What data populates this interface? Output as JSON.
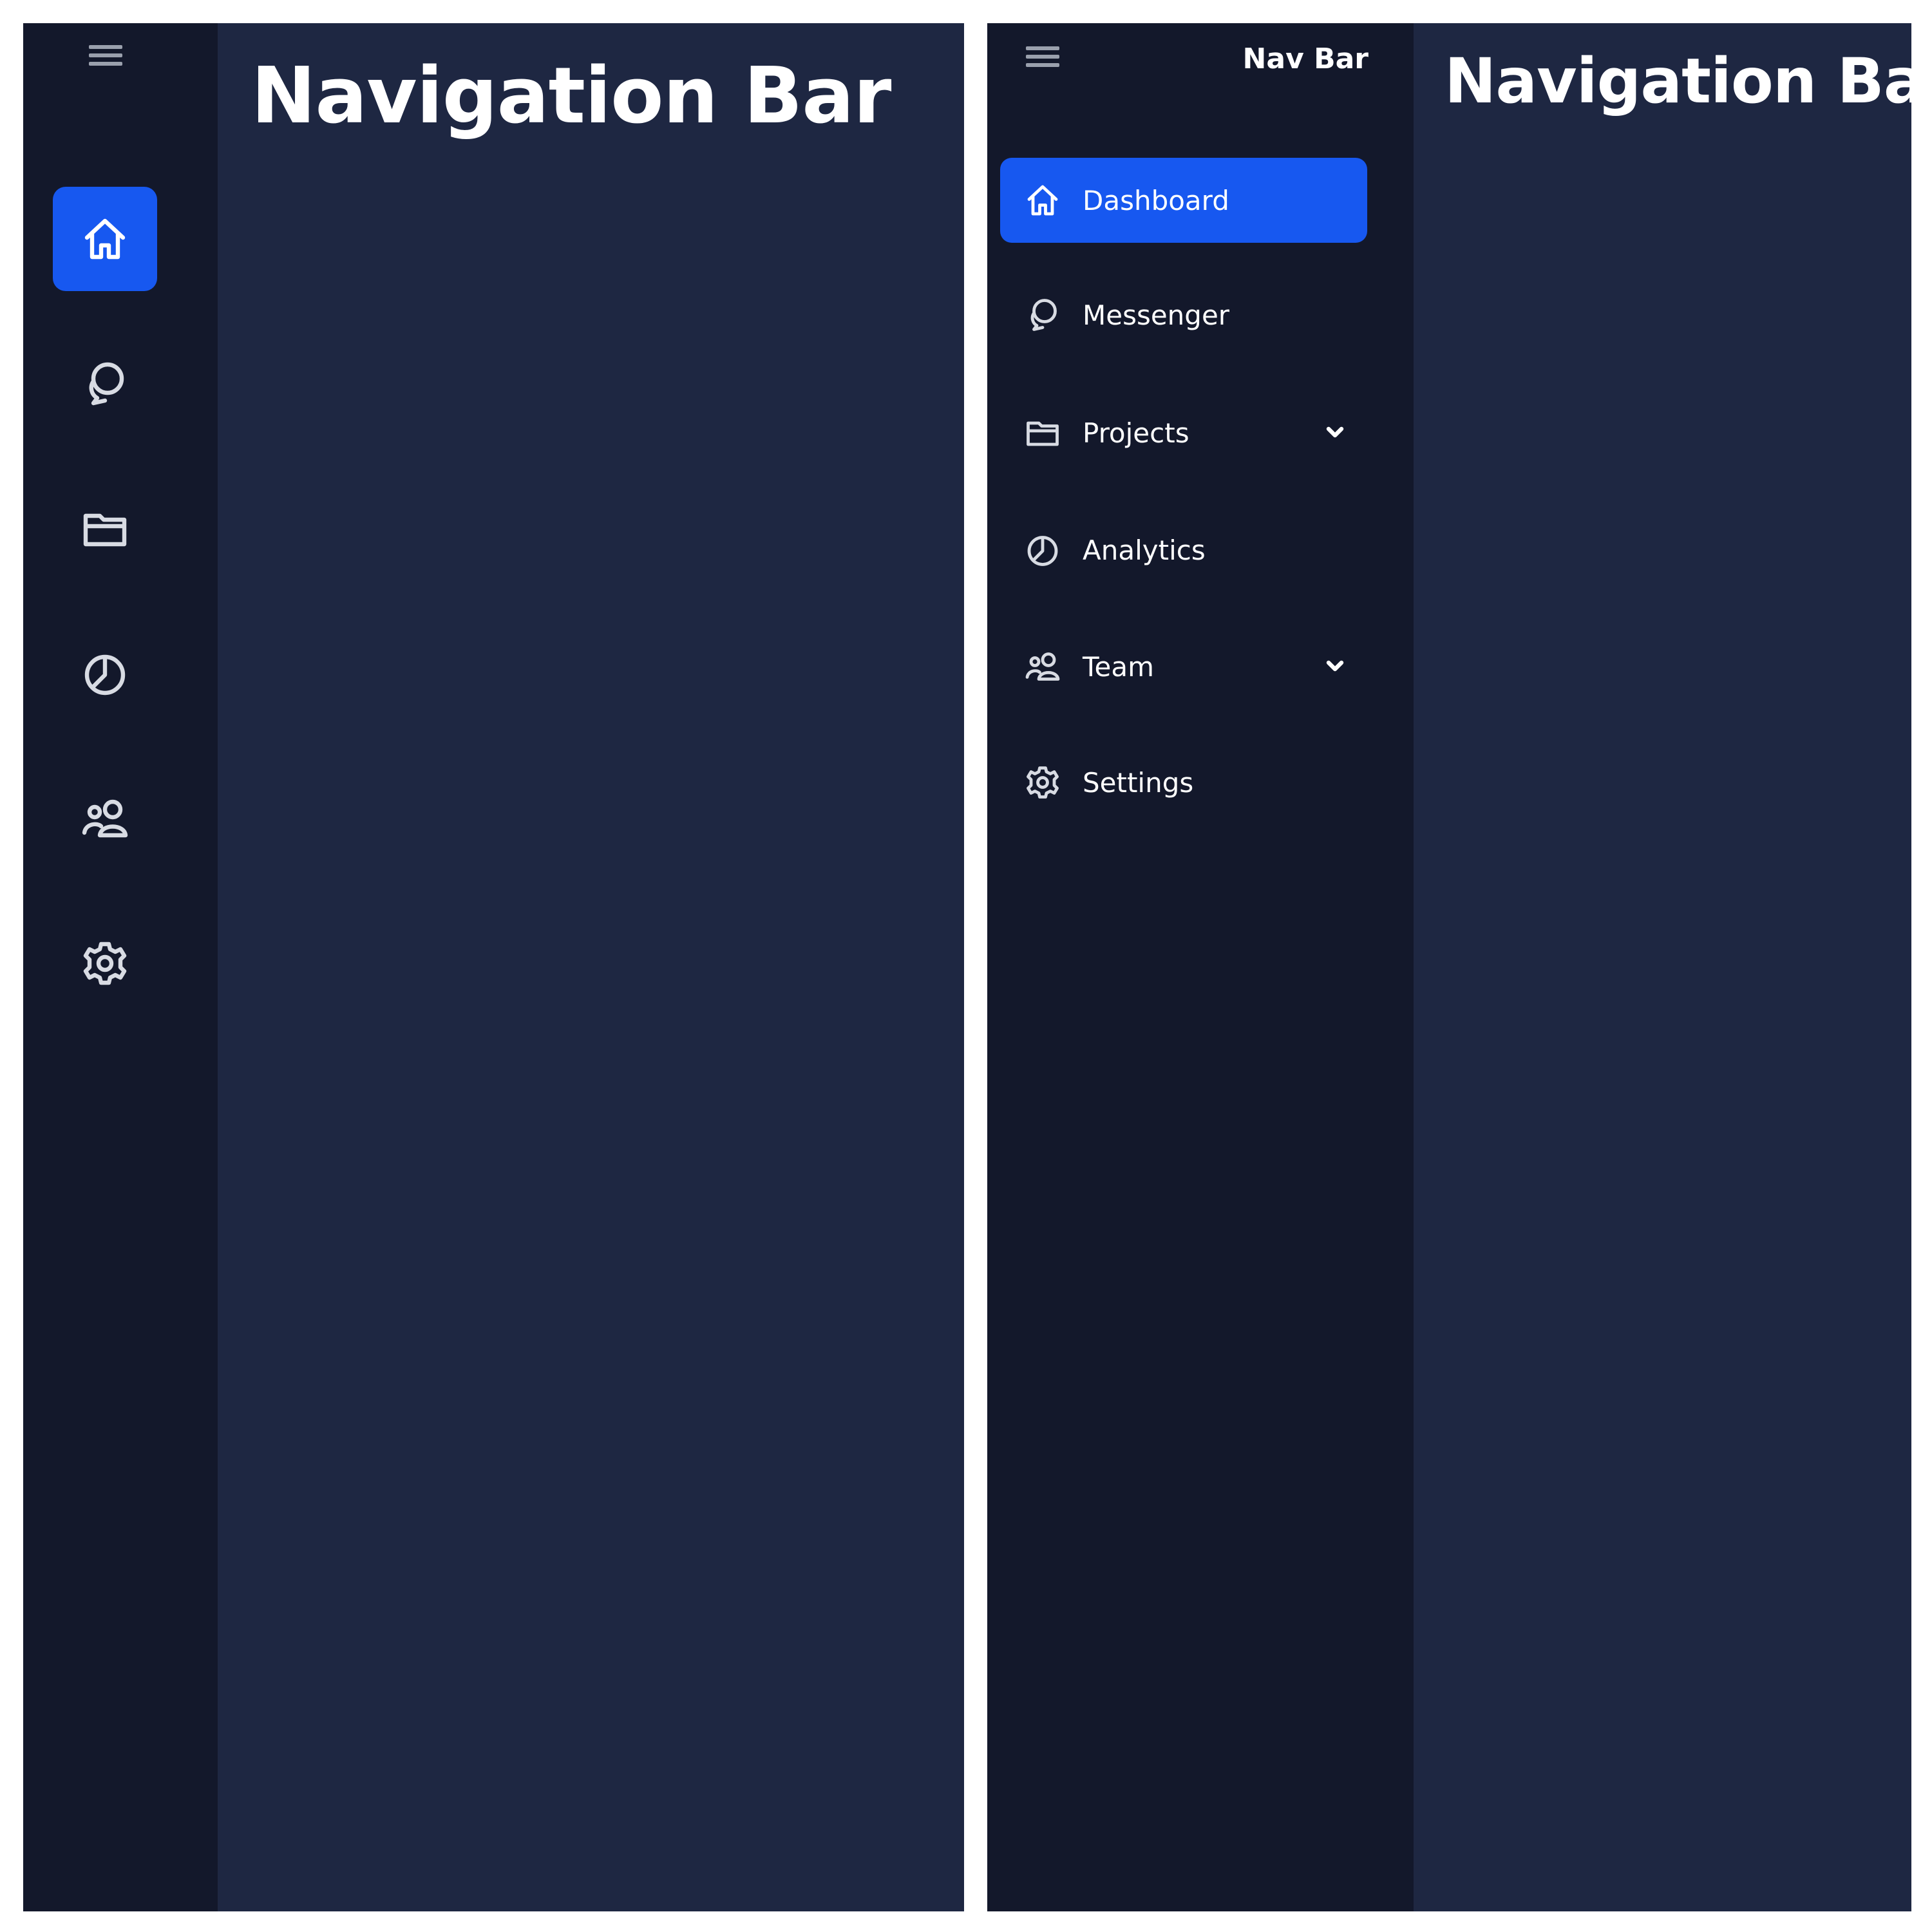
{
  "collapsed": {
    "title": "Navigation Bar",
    "menu_icon": "hamburger-icon",
    "items": [
      {
        "icon": "home-icon",
        "active": true
      },
      {
        "icon": "chat-icon",
        "active": false
      },
      {
        "icon": "folder-icon",
        "active": false
      },
      {
        "icon": "pie-chart-icon",
        "active": false
      },
      {
        "icon": "team-icon",
        "active": false
      },
      {
        "icon": "gear-icon",
        "active": false
      }
    ]
  },
  "expanded": {
    "brand": "Nav Bar",
    "title": "Navigation Bar",
    "menu_icon": "hamburger-icon",
    "items": [
      {
        "label": "Dashboard",
        "icon": "home-icon",
        "active": true,
        "has_submenu": false
      },
      {
        "label": "Messenger",
        "icon": "chat-icon",
        "active": false,
        "has_submenu": false
      },
      {
        "label": "Projects",
        "icon": "folder-icon",
        "active": false,
        "has_submenu": true
      },
      {
        "label": "Analytics",
        "icon": "pie-chart-icon",
        "active": false,
        "has_submenu": false
      },
      {
        "label": "Team",
        "icon": "team-icon",
        "active": false,
        "has_submenu": true
      },
      {
        "label": "Settings",
        "icon": "gear-icon",
        "active": false,
        "has_submenu": false
      }
    ]
  },
  "colors": {
    "sidebar_bg": "#13182b",
    "main_bg": "#1e2742",
    "accent": "#1758f0",
    "text": "#ffffff"
  }
}
